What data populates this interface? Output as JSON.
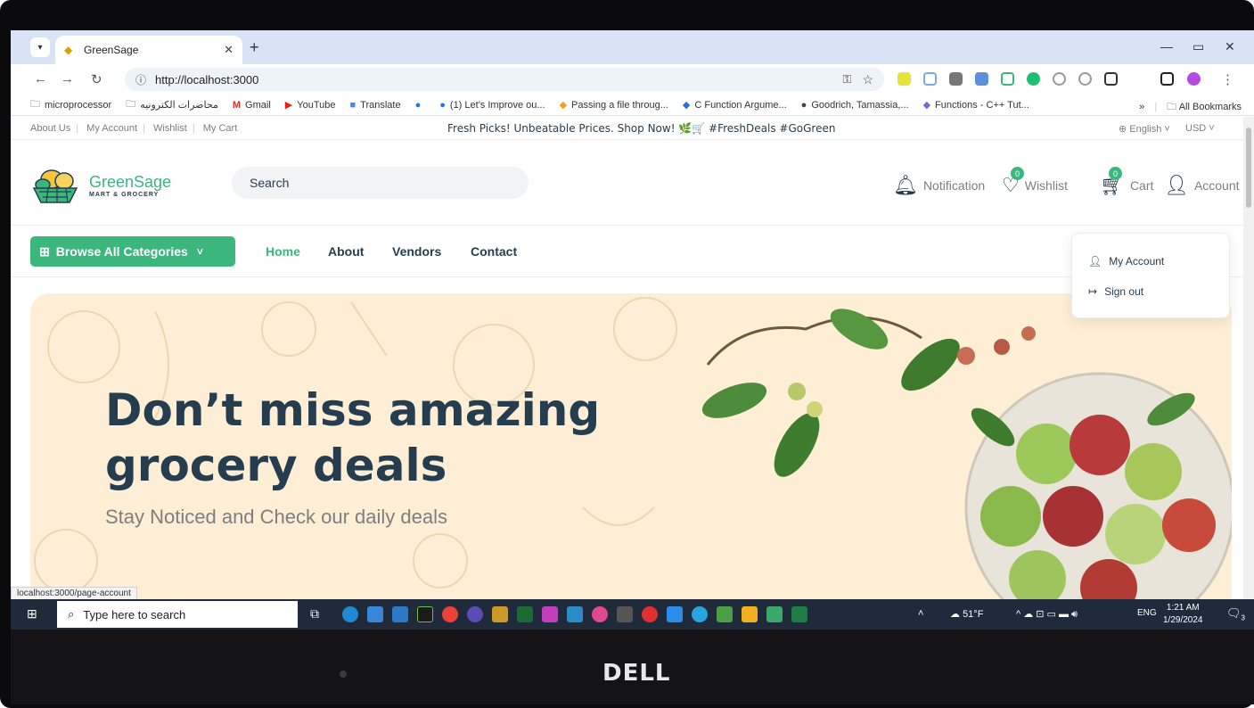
{
  "browser": {
    "tab_title": "GreenSage",
    "url": "http://localhost:3000",
    "status_url": "localhost:3000/page-account",
    "bookmarks": [
      {
        "label": "microprocessor",
        "icon": "folder-icon"
      },
      {
        "label": "محاضرات الكترونيه",
        "icon": "folder-icon"
      },
      {
        "label": "Gmail",
        "icon": "gmail-icon"
      },
      {
        "label": "YouTube",
        "icon": "youtube-icon"
      },
      {
        "label": "Translate",
        "icon": "translate-icon"
      },
      {
        "label": "",
        "icon": "facebook-icon"
      },
      {
        "label": "(1) Let's Improve ou...",
        "icon": "facebook-icon"
      },
      {
        "label": "Passing a file throug...",
        "icon": "bookmark-icon"
      },
      {
        "label": "C Function Argume...",
        "icon": "bookmark-icon"
      },
      {
        "label": "Goodrich, Tamassia,...",
        "icon": "bookmark-icon"
      },
      {
        "label": "Functions - C++ Tut...",
        "icon": "bookmark-icon"
      }
    ],
    "bookmarks_more": "»",
    "all_bookmarks": "All Bookmarks"
  },
  "topbar": {
    "links": [
      "About Us",
      "My Account",
      "Wishlist",
      "My Cart"
    ],
    "promo": "Fresh Picks! Unbeatable Prices. Shop Now! 🌿🛒 #FreshDeals #GoGreen",
    "language": "English",
    "currency": "USD"
  },
  "header": {
    "logo_name": "GreenSage",
    "logo_sub": "MART & GROCERY",
    "search_placeholder": "Search",
    "notification": "Notification",
    "wishlist": "Wishlist",
    "wishlist_count": "0",
    "cart": "Cart",
    "cart_count": "0",
    "account": "Account"
  },
  "account_menu": {
    "my_account": "My Account",
    "sign_out": "Sign out"
  },
  "menu": {
    "browse": "Browse All Categories",
    "links": [
      "Home",
      "About",
      "Vendors",
      "Contact"
    ]
  },
  "hero": {
    "title": "Don’t miss amazing grocery deals",
    "subtitle": "Stay Noticed and Check our daily deals"
  },
  "taskbar": {
    "search_placeholder": "Type here to search",
    "weather": "51°F",
    "language": "ENG",
    "time": "1:21 AM",
    "date": "1/29/2024",
    "notifications": "3"
  },
  "device": {
    "brand": "DELL"
  },
  "colors": {
    "brand_green": "#3bb77e",
    "heading": "#253d4e",
    "hero_bg": "#fdeed5"
  }
}
